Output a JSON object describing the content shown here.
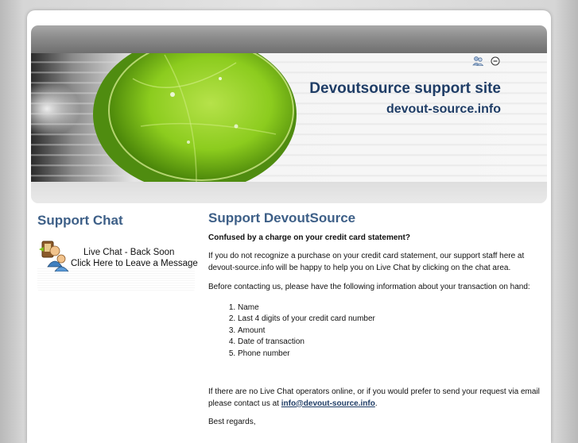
{
  "header": {
    "site_title": "Devoutsource support site",
    "site_domain": "devout-source.info",
    "icons": [
      "people-icon",
      "minus-circle-icon"
    ]
  },
  "sidebar": {
    "heading": "Support Chat",
    "chat_button": {
      "line1": "Live Chat  - Back Soon",
      "line2": "Click Here to Leave a Message"
    }
  },
  "main": {
    "heading": "Support DevoutSource",
    "lead": "Confused by a charge on your credit card statement?",
    "paragraph1": "If you do not recognize a purchase on your credit card statement, our support staff here at devout-source.info will be happy to help you on Live Chat by clicking on the chat area.",
    "paragraph2": "Before contacting us, please have the following information about your transaction on hand:",
    "list": [
      "Name",
      "Last 4 digits of your credit card number",
      "Amount",
      "Date of transaction",
      "Phone number"
    ],
    "paragraph3_before": "If there are no Live Chat operators online, or if you would prefer to send your request via email please contact us at ",
    "email": "info@devout-source.info",
    "paragraph3_after": ".",
    "closing": "Best regards,"
  },
  "colors": {
    "heading": "#3d5f87",
    "title": "#1f3d66",
    "lime": "#7ec41a"
  }
}
